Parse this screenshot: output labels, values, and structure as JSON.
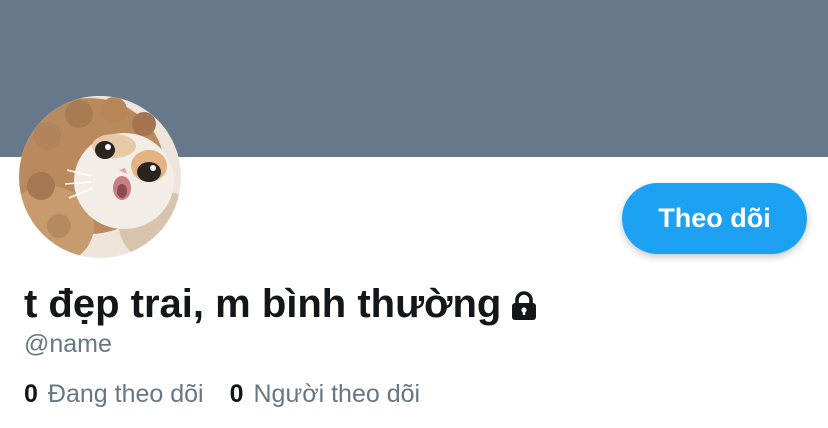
{
  "profile": {
    "display_name": "t đẹp trai, m bình thường",
    "handle": "@name",
    "protected_icon": "lock-icon",
    "avatar_subject": "cat in brown hood"
  },
  "actions": {
    "follow_label": "Theo dõi"
  },
  "stats": [
    {
      "count": "0",
      "label": "Đang theo dõi"
    },
    {
      "count": "0",
      "label": "Người theo dõi"
    }
  ],
  "colors": {
    "banner": "#66788a",
    "accent": "#1da1f2",
    "text_primary": "#14171a",
    "text_secondary": "#657786"
  }
}
